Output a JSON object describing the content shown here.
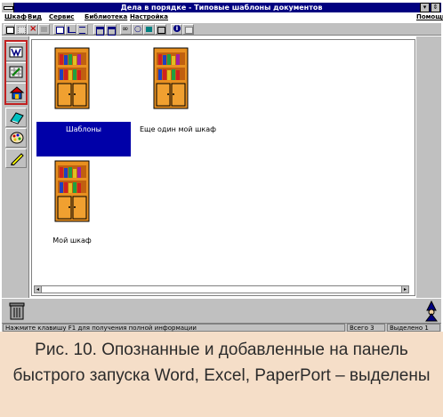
{
  "window": {
    "title": "Дела в порядке - Типовые шаблоны документов",
    "minimize_glyph": "▾",
    "restore_glyph": "⇕"
  },
  "menu": {
    "items": [
      "Шкаф",
      "Вид",
      "Сервис",
      "Библиотека",
      "Настройка"
    ],
    "help": "Помощь"
  },
  "cabinets": [
    {
      "label": "Шаблоны",
      "selected": true
    },
    {
      "label": "Еще один мой шкаф",
      "selected": false
    },
    {
      "label": "Мой шкаф",
      "selected": false
    }
  ],
  "quick_launch": {
    "items": [
      "word-icon",
      "excel-icon",
      "paperport-icon",
      "notebook-icon",
      "palette-icon",
      "pen-icon"
    ],
    "highlight_color": "#c02020"
  },
  "status": {
    "hint": "Нажмите клавишу F1 для получения полной информации",
    "total": "Всего 3",
    "selected": "Выделено 1"
  },
  "caption": {
    "text": "Рис. 10. Опознанные и добавленные на панель быстрого запуска Word, Excel, PaperPort – выделены"
  },
  "colors": {
    "titlebar": "#000080",
    "selection": "#0000a8",
    "chrome": "#c0c0c0",
    "caption_bg": "#f5dec8"
  }
}
